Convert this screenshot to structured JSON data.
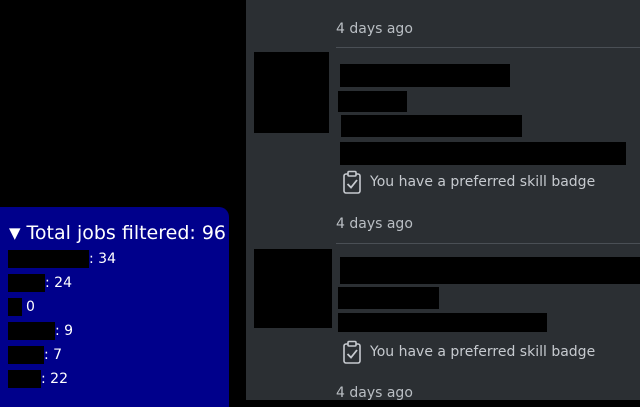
{
  "feed": {
    "items": [
      {
        "time": "4 days ago"
      },
      {
        "time": "4 days ago",
        "badge": "You have a preferred skill badge"
      },
      {
        "time": "4 days ago",
        "badge": "You have a preferred skill badge"
      }
    ]
  },
  "filter": {
    "toggle_icon": "triangle-down-icon",
    "title": "Total jobs filtered: 96",
    "rows": [
      {
        "value": ": 34"
      },
      {
        "value": ": 24"
      },
      {
        "value": "0"
      },
      {
        "value": ": 9"
      },
      {
        "value": ": 7"
      },
      {
        "value": ": 22"
      }
    ]
  }
}
